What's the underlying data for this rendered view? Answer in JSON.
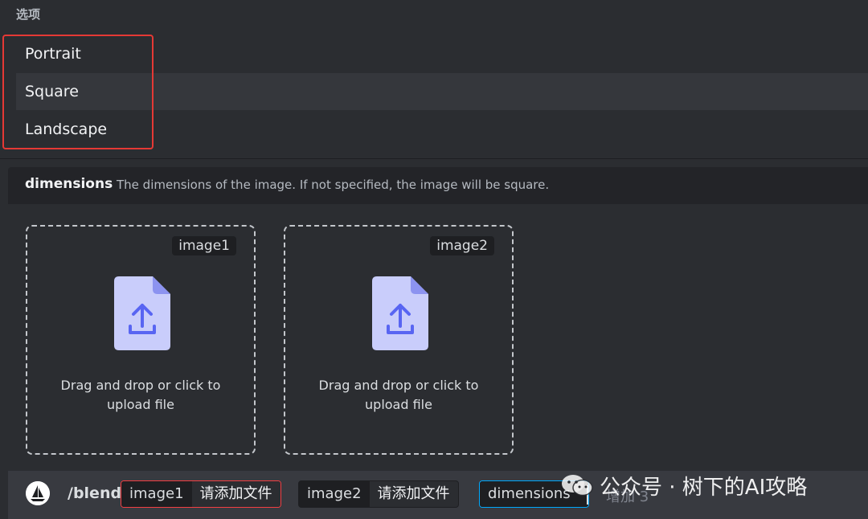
{
  "options": {
    "header": "选项",
    "items": [
      {
        "label": "Portrait",
        "selected": false
      },
      {
        "label": "Square",
        "selected": true
      },
      {
        "label": "Landscape",
        "selected": false
      }
    ]
  },
  "dimension_hint": {
    "name": "dimensions",
    "description": "The dimensions of the image. If not specified, the image will be square."
  },
  "uploads": [
    {
      "label": "image1",
      "text": "Drag and drop or click to upload file",
      "icon": "upload-file-icon"
    },
    {
      "label": "image2",
      "text": "Drag and drop or click to upload file",
      "icon": "upload-file-icon"
    }
  ],
  "command": {
    "bot_icon": "sailboat-avatar-icon",
    "name": "/blend",
    "params": [
      {
        "key": "image1",
        "value": "请添加文件",
        "state": "error"
      },
      {
        "key": "image2",
        "value": "请添加文件",
        "state": "normal"
      },
      {
        "key": "dimensions",
        "value": "",
        "state": "active"
      }
    ],
    "more": "增加 3"
  },
  "watermark": {
    "icon": "wechat-icon",
    "text": "公众号 · 树下的AI攻略"
  },
  "colors": {
    "background": "#2b2d31",
    "input_bar": "#383a40",
    "selected_row": "#35373c",
    "highlight": "#e53935",
    "error_border": "#f23f43",
    "active_border": "#00a8fc",
    "upload_icon": "#c9cdfb",
    "upload_arrow": "#5865f2"
  }
}
